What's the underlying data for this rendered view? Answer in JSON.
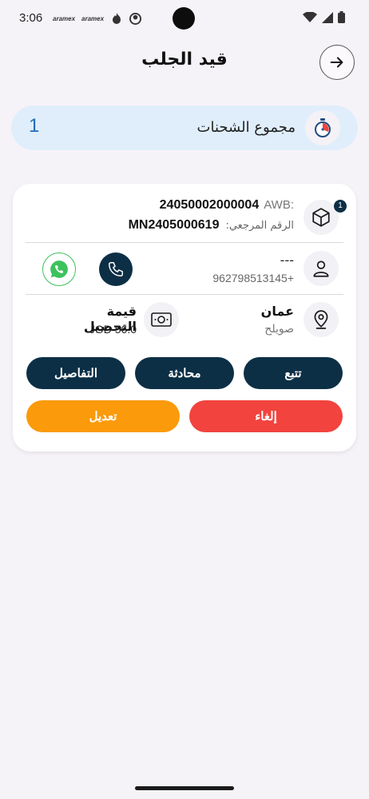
{
  "status_bar": {
    "time": "3:06",
    "notifications": [
      "aramex-icon",
      "aramex-icon",
      "flame-app-icon",
      "smiley-app-icon"
    ],
    "system_icons": [
      "wifi-icon",
      "signal-icon",
      "battery-icon"
    ]
  },
  "header": {
    "title": "قيد الجلب",
    "back_icon": "arrow-right-icon"
  },
  "summary": {
    "label": "مجموع الشحنات",
    "count": "1",
    "icon": "stopwatch-icon"
  },
  "shipment": {
    "badge": "1",
    "awb_label": "AWB:",
    "awb_value": "24050002000004",
    "ref_label": "الرقم المرجعي:",
    "ref_value": "MN2405000619",
    "customer_name": "---",
    "customer_phone": "962798513145+",
    "city": "عمان",
    "district": "صويلح",
    "cod_label": "قيمة التحصيل",
    "cod_value": "JOD 56.0",
    "buttons": {
      "track": "تتبع",
      "chat": "محادثة",
      "details": "التفاصيل",
      "cancel": "إلغاء",
      "edit": "تعديل"
    }
  },
  "colors": {
    "primary": "#0c2f45",
    "cancel": "#f2433e",
    "edit": "#fb9a0b",
    "summary_bg": "#e0eefb",
    "count": "#1e6fb7",
    "whatsapp": "#3cc25d"
  }
}
